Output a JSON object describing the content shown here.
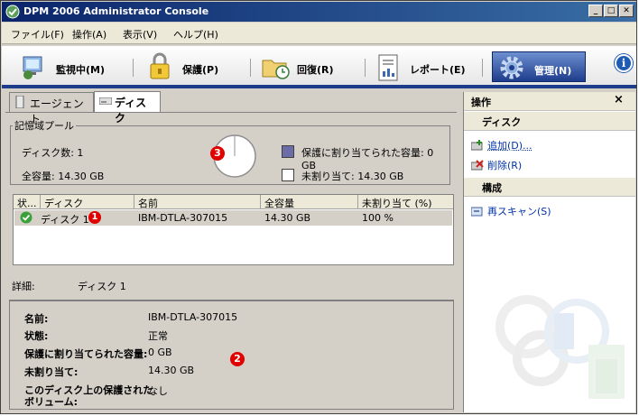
{
  "window": {
    "title": "DPM 2006 Administrator Console"
  },
  "menu": [
    "ファイル(F)",
    "操作(A)",
    "表示(V)",
    "ヘルプ(H)"
  ],
  "nav": {
    "tabs": [
      {
        "label": "監視中(M)",
        "icon": "monitor-icon"
      },
      {
        "label": "保護(P)",
        "icon": "lock-icon"
      },
      {
        "label": "回復(R)",
        "icon": "recovery-folder-icon"
      },
      {
        "label": "レポート(E)",
        "icon": "report-icon"
      },
      {
        "label": "管理(N)",
        "icon": "gear-icon",
        "active": true
      }
    ]
  },
  "subtabs": {
    "agent": "エージェント",
    "disk": "ディスク"
  },
  "pool": {
    "legend": "記憶域プール",
    "disk_count": "ディスク数: 1",
    "total": "全容量: 14.30 GB",
    "allocated_label": "保護に割り当てられた容量: 0 GB",
    "unallocated_label": "未割り当て: 14.30 GB",
    "allocated_color": "#6c6ca8",
    "unallocated_color": "#ffffff"
  },
  "table": {
    "columns": [
      "状...",
      "ディスク",
      "名前",
      "全容量",
      "未割り当て (%)"
    ],
    "rows": [
      {
        "status": "ok",
        "disk": "ディスク 1",
        "name": "IBM-DTLA-307015",
        "total": "14.30 GB",
        "unallocated": "100 %"
      }
    ]
  },
  "details": {
    "label": "詳細:",
    "selected": "ディスク 1",
    "fields": [
      {
        "label": "名前:",
        "value": "IBM-DTLA-307015"
      },
      {
        "label": "状態:",
        "value": "正常"
      },
      {
        "label": "保護に割り当てられた容量:",
        "value": "0 GB"
      },
      {
        "label": "未割り当て:",
        "value": "14.30 GB"
      },
      {
        "label": "このディスク上の保護された",
        "label2": "ボリューム:",
        "value": "なし"
      }
    ]
  },
  "actions": {
    "title": "操作",
    "close": "×",
    "disk_section": "ディスク",
    "add": "追加(D)...",
    "remove": "削除(R)",
    "config_section": "構成",
    "rescan": "再スキャン(S)"
  },
  "badges": {
    "one": "1",
    "two": "2",
    "three": "3"
  }
}
